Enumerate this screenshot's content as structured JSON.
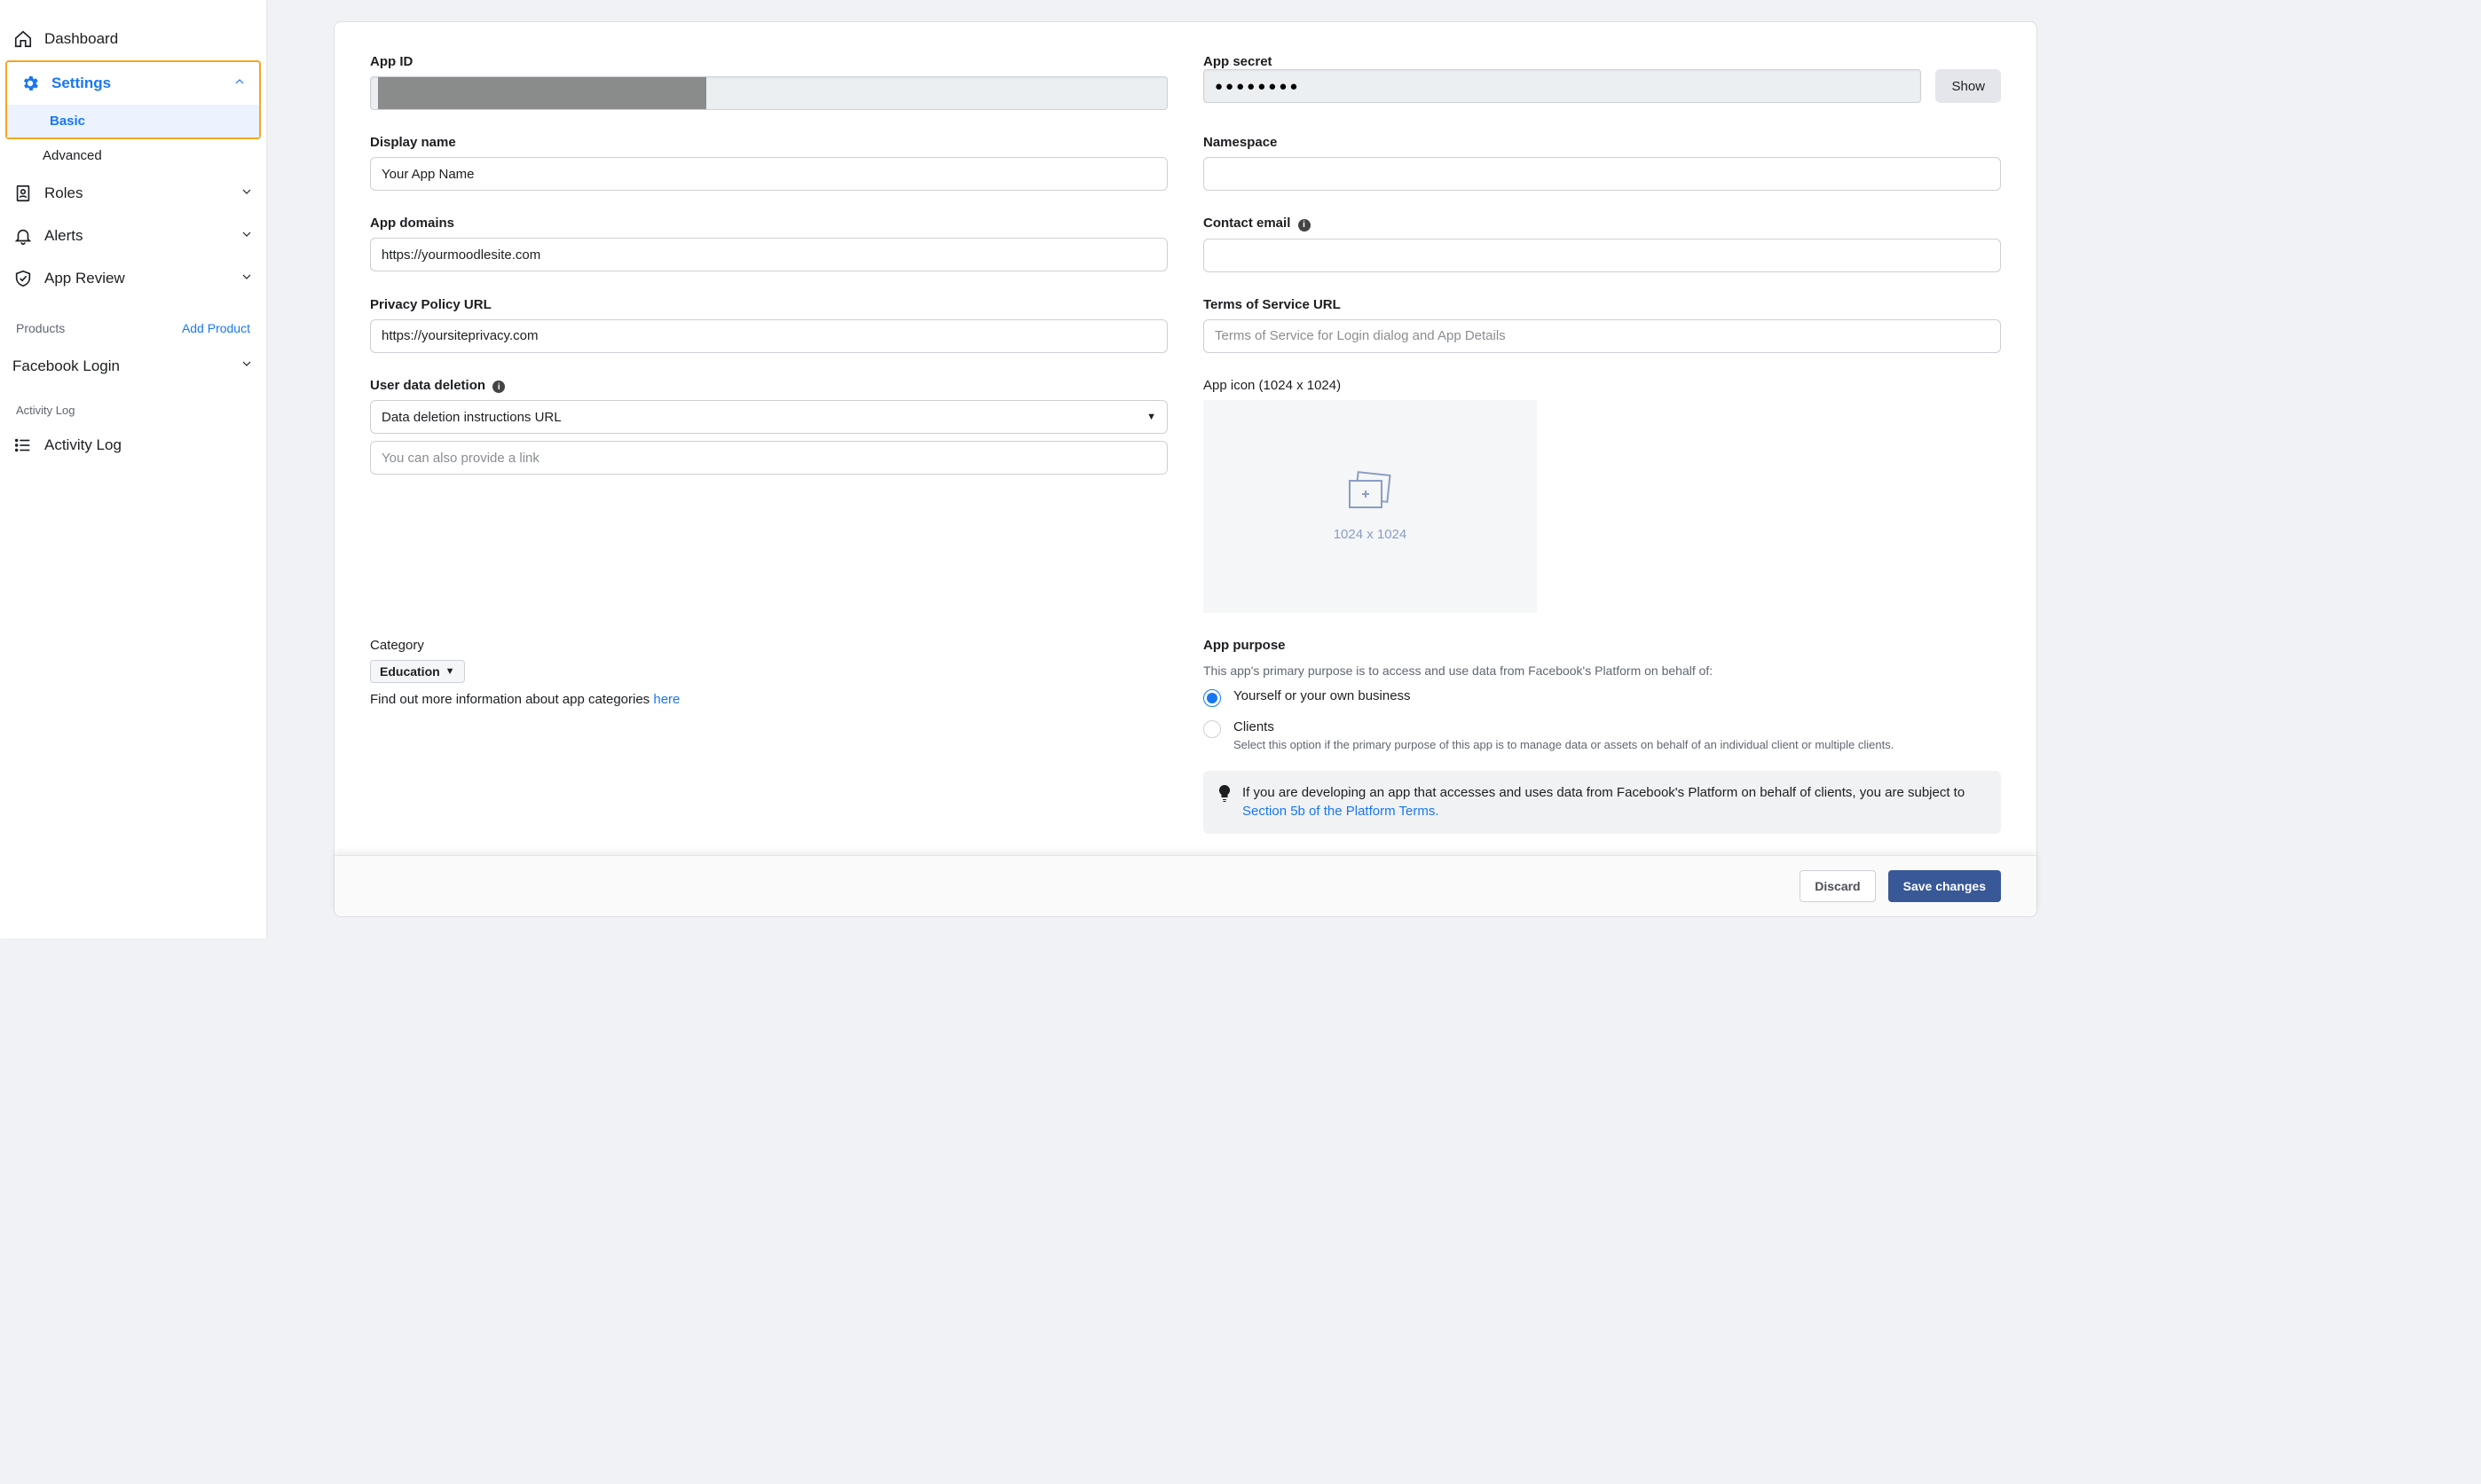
{
  "sidebar": {
    "dashboard": "Dashboard",
    "settings": "Settings",
    "settings_sub": {
      "basic": "Basic",
      "advanced": "Advanced"
    },
    "roles": "Roles",
    "alerts": "Alerts",
    "app_review": "App Review",
    "products_heading": "Products",
    "add_product": "Add Product",
    "facebook_login": "Facebook Login",
    "activity_heading": "Activity Log",
    "activity_log": "Activity Log"
  },
  "form": {
    "app_id_label": "App ID",
    "app_secret_label": "App secret",
    "app_secret_value": "●●●●●●●●",
    "show_btn": "Show",
    "display_name_label": "Display name",
    "display_name_value": "Your App Name",
    "namespace_label": "Namespace",
    "namespace_value": "",
    "app_domains_label": "App domains",
    "app_domains_value": "https://yourmoodlesite.com",
    "contact_email_label": "Contact email",
    "contact_email_value": "",
    "privacy_label": "Privacy Policy URL",
    "privacy_value": "https://yoursiteprivacy.com",
    "tos_label": "Terms of Service URL",
    "tos_placeholder": "Terms of Service for Login dialog and App Details",
    "udd_label": "User data deletion",
    "udd_select": "Data deletion instructions URL",
    "udd_link_placeholder": "You can also provide a link",
    "app_icon_label": "App icon (1024 x 1024)",
    "app_icon_placeholder_text": "1024 x 1024",
    "category_label": "Category",
    "category_value": "Education",
    "category_help": "Find out more information about app categories ",
    "category_link": "here",
    "purpose_label": "App purpose",
    "purpose_desc": "This app's primary purpose is to access and use data from Facebook's Platform on behalf of:",
    "purpose_opt1": "Yourself or your own business",
    "purpose_opt2": "Clients",
    "purpose_opt2_desc": "Select this option if the primary purpose of this app is to manage data or assets on behalf of an individual client or multiple clients.",
    "banner_text": "If you are developing an app that accesses and uses data from Facebook's Platform on behalf of clients, you are subject to ",
    "banner_link": "Section 5b of the Platform Terms."
  },
  "footer": {
    "discard": "Discard",
    "save": "Save changes"
  }
}
